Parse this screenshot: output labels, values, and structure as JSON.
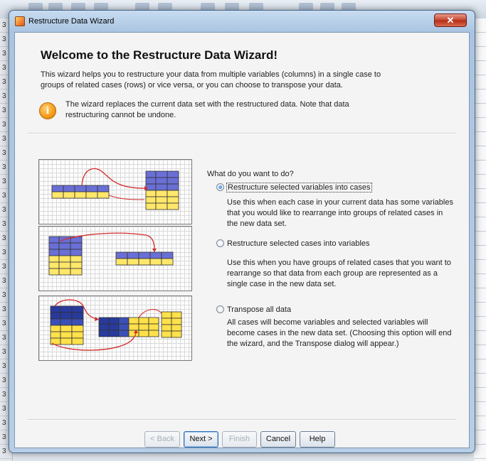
{
  "window": {
    "title": "Restructure Data Wizard",
    "close_label": "✕"
  },
  "header": {
    "title": "Welcome to the Restructure Data Wizard!",
    "intro_line1": "This wizard helps you to restructure your data from multiple variables (columns) in a single case to",
    "intro_line2": "groups of related cases (rows) or vice versa, or you can choose to transpose your data.",
    "info_glyph": "i",
    "note_line1": "The wizard replaces the current data set with the restructured data.  Note that data",
    "note_line2": "restructuring cannot be undone."
  },
  "question": "What do you want to do?",
  "options": [
    {
      "label": "Restructure selected variables into cases",
      "selected": true,
      "description": "Use this when each case in your current data has some variables that you would like to rearrange into groups of related cases in the new data set."
    },
    {
      "label": "Restructure selected cases into variables",
      "selected": false,
      "description": "Use this when you have groups of related cases that you want to rearrange so that data from each group are represented as a single case in the new data set."
    },
    {
      "label": "Transpose all data",
      "selected": false,
      "description": "All cases will become variables and selected variables will become cases in the new data set. (Choosing this option will end the wizard, and the Transpose dialog will appear.)"
    }
  ],
  "buttons": {
    "back": "< Back",
    "next": "Next >",
    "finish": "Finish",
    "cancel": "Cancel",
    "help": "Help"
  },
  "background_row_labels": [
    "3",
    "3",
    "3",
    "3",
    "3",
    "3",
    "3",
    "3",
    "3",
    "3",
    "3",
    "3",
    "3",
    "3",
    "3",
    "3",
    "3",
    "3",
    "3",
    "3",
    "3",
    "3",
    "3",
    "3",
    "3",
    "3",
    "3",
    "3",
    "3",
    "3",
    "3"
  ],
  "colors": {
    "accent": "#1c6cc2",
    "arrow_red": "#d42a2a",
    "cell_purple": "#6a6fd6",
    "cell_dark_blue": "#283a9c",
    "cell_yellow": "#ffe14a"
  }
}
